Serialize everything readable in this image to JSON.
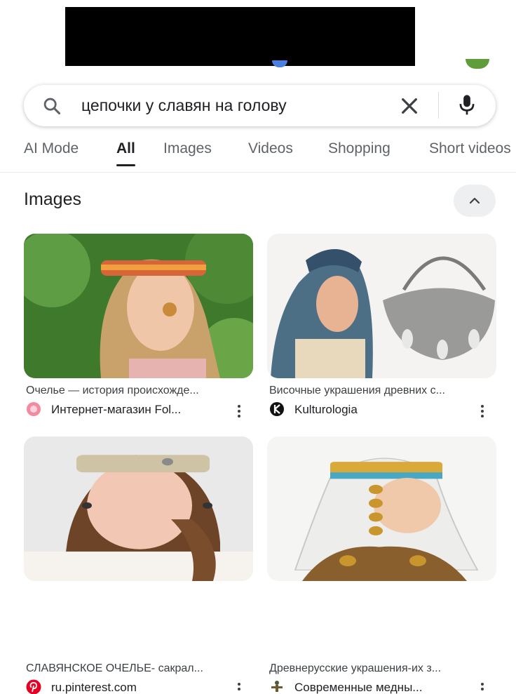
{
  "search": {
    "query": "цепочки у славян на голову"
  },
  "tabs": [
    {
      "label": "AI Mode"
    },
    {
      "label": "All"
    },
    {
      "label": "Images"
    },
    {
      "label": "Videos"
    },
    {
      "label": "Shopping"
    },
    {
      "label": "Short videos"
    }
  ],
  "images_section": {
    "title": "Images"
  },
  "results": [
    {
      "title": "Очелье — история происхожде...",
      "source": "Интернет-магазин Fol...",
      "favicon": "flower-favicon-icon"
    },
    {
      "title": "Височные украшения древних с...",
      "source": "Kulturologia",
      "favicon": "k-favicon-icon"
    },
    {
      "title": "СЛАВЯНСКОЕ ОЧЕЛЬЕ- сакрал...",
      "source": "ru.pinterest.com",
      "favicon": "pinterest-icon"
    },
    {
      "title": "Древнерусские украшения-их з...",
      "source": "Современные медны...",
      "favicon": "figure-favicon-icon"
    }
  ],
  "colors": {
    "accent": "#202124",
    "muted": "#5f6368",
    "pinterest": "#e60023"
  }
}
